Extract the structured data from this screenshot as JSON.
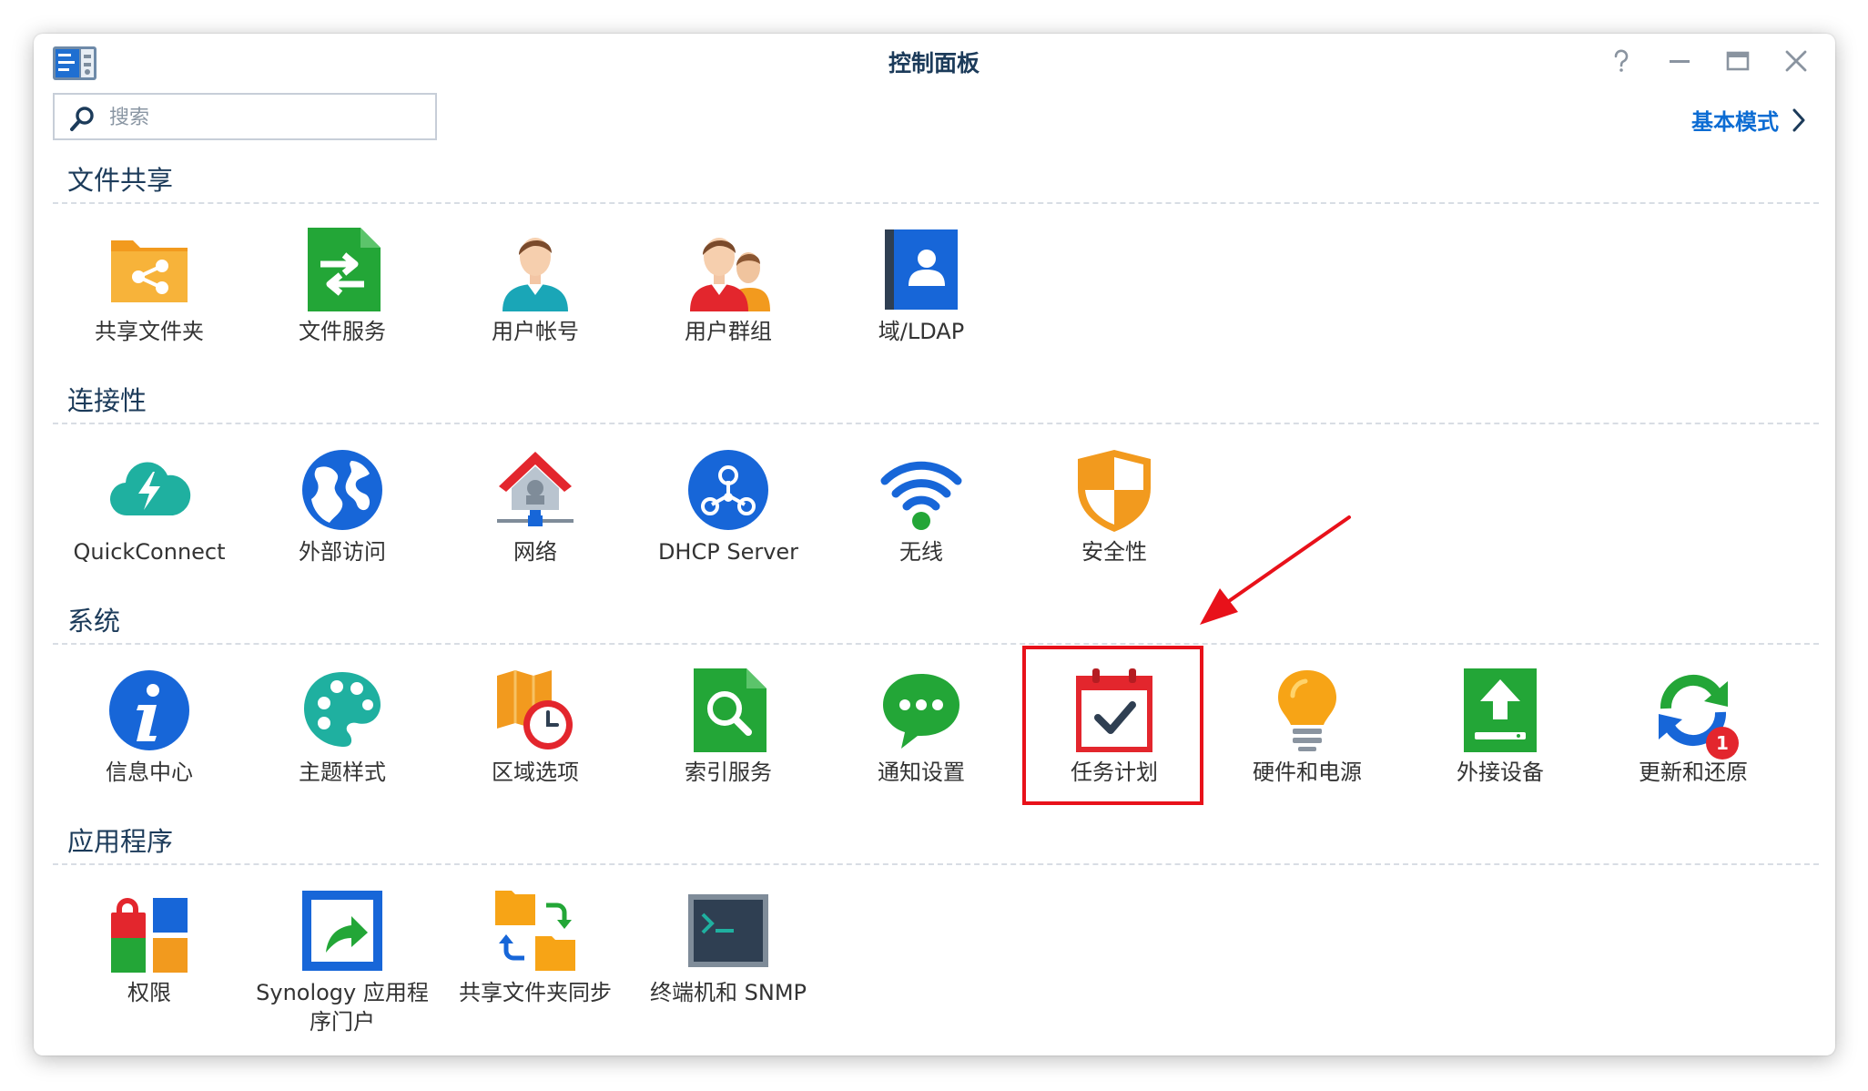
{
  "window": {
    "title": "控制面板"
  },
  "controls": {
    "help_icon": "question-mark",
    "minimize_icon": "minus",
    "maximize_icon": "square",
    "close_icon": "x"
  },
  "search": {
    "placeholder": "搜索",
    "value": ""
  },
  "mode_switch": {
    "label": "基本模式"
  },
  "highlight_color": "#e8111a",
  "sections": [
    {
      "title": "文件共享",
      "items": [
        {
          "label": "共享文件夹",
          "icon": "shared-folder-icon"
        },
        {
          "label": "文件服务",
          "icon": "file-services-icon"
        },
        {
          "label": "用户帐号",
          "icon": "user-icon"
        },
        {
          "label": "用户群组",
          "icon": "group-icon"
        },
        {
          "label": "域/LDAP",
          "icon": "ldap-icon"
        }
      ]
    },
    {
      "title": "连接性",
      "items": [
        {
          "label": "QuickConnect",
          "icon": "quickconnect-icon"
        },
        {
          "label": "外部访问",
          "icon": "globe-icon"
        },
        {
          "label": "网络",
          "icon": "network-icon"
        },
        {
          "label": "DHCP Server",
          "icon": "dhcp-icon"
        },
        {
          "label": "无线",
          "icon": "wifi-icon"
        },
        {
          "label": "安全性",
          "icon": "shield-icon"
        }
      ]
    },
    {
      "title": "系统",
      "items": [
        {
          "label": "信息中心",
          "icon": "info-icon"
        },
        {
          "label": "主题样式",
          "icon": "palette-icon"
        },
        {
          "label": "区域选项",
          "icon": "regional-clock-icon"
        },
        {
          "label": "索引服务",
          "icon": "indexing-icon"
        },
        {
          "label": "通知设置",
          "icon": "chat-bubble-icon"
        },
        {
          "label": "任务计划",
          "icon": "calendar-check-icon"
        },
        {
          "label": "硬件和电源",
          "icon": "lightbulb-icon"
        },
        {
          "label": "外接设备",
          "icon": "upload-icon"
        },
        {
          "label": "更新和还原",
          "icon": "refresh-icon",
          "badge": "1"
        }
      ]
    },
    {
      "title": "应用程序",
      "items": [
        {
          "label": "权限",
          "icon": "privileges-icon"
        },
        {
          "label": "Synology 应用程序门户",
          "icon": "portal-icon"
        },
        {
          "label": "共享文件夹同步",
          "icon": "folder-sync-icon"
        },
        {
          "label": "终端机和 SNMP",
          "icon": "terminal-icon"
        }
      ]
    }
  ]
}
